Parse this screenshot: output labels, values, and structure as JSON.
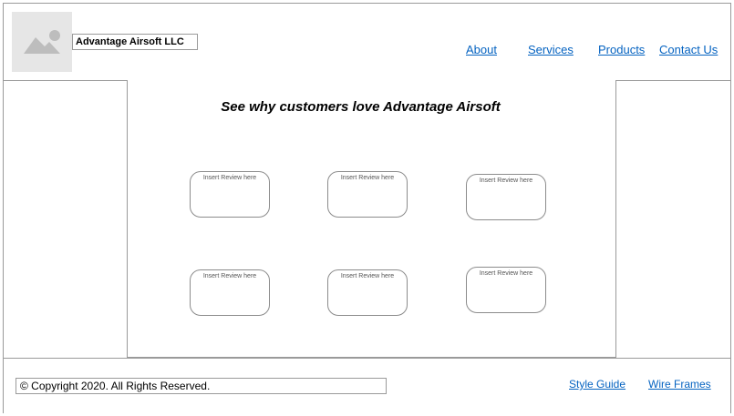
{
  "header": {
    "company_name": "Advantage Airsoft LLC",
    "logo_icon": "image-placeholder-icon",
    "nav": [
      {
        "label": "About"
      },
      {
        "label": "Services"
      },
      {
        "label": "Products"
      },
      {
        "label": "Contact Us"
      }
    ]
  },
  "main": {
    "headline": "See why customers love Advantage Airsoft",
    "reviews": [
      {
        "text": "Insert Review here"
      },
      {
        "text": "Insert Review here"
      },
      {
        "text": "Insert Review here"
      },
      {
        "text": "Insert Review here"
      },
      {
        "text": "Insert Review here"
      },
      {
        "text": "Insert Review here"
      }
    ]
  },
  "footer": {
    "copyright": "© Copyright 2020. All Rights Reserved.",
    "links": [
      {
        "label": "Style Guide"
      },
      {
        "label": "Wire Frames"
      }
    ]
  },
  "colors": {
    "link": "#0563c1",
    "border": "#9a9a9a",
    "placeholder_bg": "#e6e6e6",
    "placeholder_shape": "#bdbdbd"
  }
}
